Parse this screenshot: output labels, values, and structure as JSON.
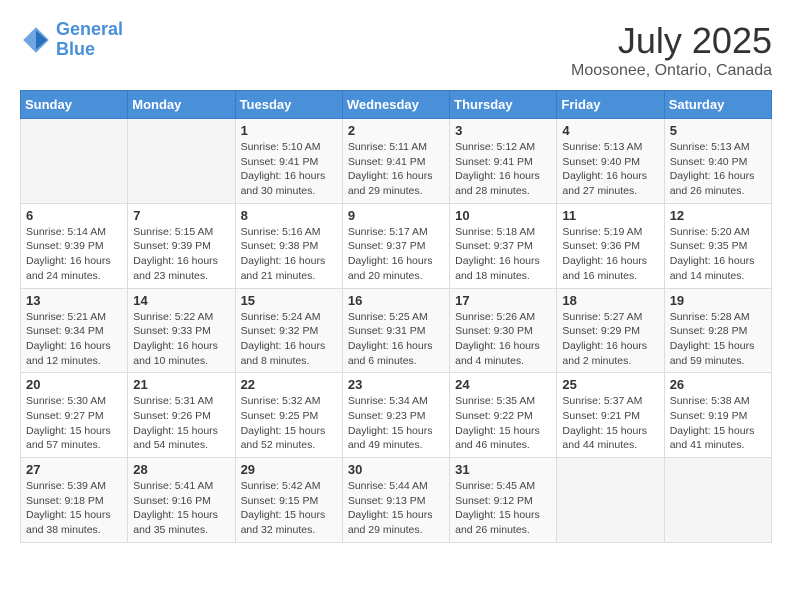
{
  "header": {
    "logo_line1": "General",
    "logo_line2": "Blue",
    "title": "July 2025",
    "subtitle": "Moosonee, Ontario, Canada"
  },
  "weekdays": [
    "Sunday",
    "Monday",
    "Tuesday",
    "Wednesday",
    "Thursday",
    "Friday",
    "Saturday"
  ],
  "weeks": [
    [
      {
        "day": "",
        "content": ""
      },
      {
        "day": "",
        "content": ""
      },
      {
        "day": "1",
        "content": "Sunrise: 5:10 AM\nSunset: 9:41 PM\nDaylight: 16 hours\nand 30 minutes."
      },
      {
        "day": "2",
        "content": "Sunrise: 5:11 AM\nSunset: 9:41 PM\nDaylight: 16 hours\nand 29 minutes."
      },
      {
        "day": "3",
        "content": "Sunrise: 5:12 AM\nSunset: 9:41 PM\nDaylight: 16 hours\nand 28 minutes."
      },
      {
        "day": "4",
        "content": "Sunrise: 5:13 AM\nSunset: 9:40 PM\nDaylight: 16 hours\nand 27 minutes."
      },
      {
        "day": "5",
        "content": "Sunrise: 5:13 AM\nSunset: 9:40 PM\nDaylight: 16 hours\nand 26 minutes."
      }
    ],
    [
      {
        "day": "6",
        "content": "Sunrise: 5:14 AM\nSunset: 9:39 PM\nDaylight: 16 hours\nand 24 minutes."
      },
      {
        "day": "7",
        "content": "Sunrise: 5:15 AM\nSunset: 9:39 PM\nDaylight: 16 hours\nand 23 minutes."
      },
      {
        "day": "8",
        "content": "Sunrise: 5:16 AM\nSunset: 9:38 PM\nDaylight: 16 hours\nand 21 minutes."
      },
      {
        "day": "9",
        "content": "Sunrise: 5:17 AM\nSunset: 9:37 PM\nDaylight: 16 hours\nand 20 minutes."
      },
      {
        "day": "10",
        "content": "Sunrise: 5:18 AM\nSunset: 9:37 PM\nDaylight: 16 hours\nand 18 minutes."
      },
      {
        "day": "11",
        "content": "Sunrise: 5:19 AM\nSunset: 9:36 PM\nDaylight: 16 hours\nand 16 minutes."
      },
      {
        "day": "12",
        "content": "Sunrise: 5:20 AM\nSunset: 9:35 PM\nDaylight: 16 hours\nand 14 minutes."
      }
    ],
    [
      {
        "day": "13",
        "content": "Sunrise: 5:21 AM\nSunset: 9:34 PM\nDaylight: 16 hours\nand 12 minutes."
      },
      {
        "day": "14",
        "content": "Sunrise: 5:22 AM\nSunset: 9:33 PM\nDaylight: 16 hours\nand 10 minutes."
      },
      {
        "day": "15",
        "content": "Sunrise: 5:24 AM\nSunset: 9:32 PM\nDaylight: 16 hours\nand 8 minutes."
      },
      {
        "day": "16",
        "content": "Sunrise: 5:25 AM\nSunset: 9:31 PM\nDaylight: 16 hours\nand 6 minutes."
      },
      {
        "day": "17",
        "content": "Sunrise: 5:26 AM\nSunset: 9:30 PM\nDaylight: 16 hours\nand 4 minutes."
      },
      {
        "day": "18",
        "content": "Sunrise: 5:27 AM\nSunset: 9:29 PM\nDaylight: 16 hours\nand 2 minutes."
      },
      {
        "day": "19",
        "content": "Sunrise: 5:28 AM\nSunset: 9:28 PM\nDaylight: 15 hours\nand 59 minutes."
      }
    ],
    [
      {
        "day": "20",
        "content": "Sunrise: 5:30 AM\nSunset: 9:27 PM\nDaylight: 15 hours\nand 57 minutes."
      },
      {
        "day": "21",
        "content": "Sunrise: 5:31 AM\nSunset: 9:26 PM\nDaylight: 15 hours\nand 54 minutes."
      },
      {
        "day": "22",
        "content": "Sunrise: 5:32 AM\nSunset: 9:25 PM\nDaylight: 15 hours\nand 52 minutes."
      },
      {
        "day": "23",
        "content": "Sunrise: 5:34 AM\nSunset: 9:23 PM\nDaylight: 15 hours\nand 49 minutes."
      },
      {
        "day": "24",
        "content": "Sunrise: 5:35 AM\nSunset: 9:22 PM\nDaylight: 15 hours\nand 46 minutes."
      },
      {
        "day": "25",
        "content": "Sunrise: 5:37 AM\nSunset: 9:21 PM\nDaylight: 15 hours\nand 44 minutes."
      },
      {
        "day": "26",
        "content": "Sunrise: 5:38 AM\nSunset: 9:19 PM\nDaylight: 15 hours\nand 41 minutes."
      }
    ],
    [
      {
        "day": "27",
        "content": "Sunrise: 5:39 AM\nSunset: 9:18 PM\nDaylight: 15 hours\nand 38 minutes."
      },
      {
        "day": "28",
        "content": "Sunrise: 5:41 AM\nSunset: 9:16 PM\nDaylight: 15 hours\nand 35 minutes."
      },
      {
        "day": "29",
        "content": "Sunrise: 5:42 AM\nSunset: 9:15 PM\nDaylight: 15 hours\nand 32 minutes."
      },
      {
        "day": "30",
        "content": "Sunrise: 5:44 AM\nSunset: 9:13 PM\nDaylight: 15 hours\nand 29 minutes."
      },
      {
        "day": "31",
        "content": "Sunrise: 5:45 AM\nSunset: 9:12 PM\nDaylight: 15 hours\nand 26 minutes."
      },
      {
        "day": "",
        "content": ""
      },
      {
        "day": "",
        "content": ""
      }
    ]
  ]
}
